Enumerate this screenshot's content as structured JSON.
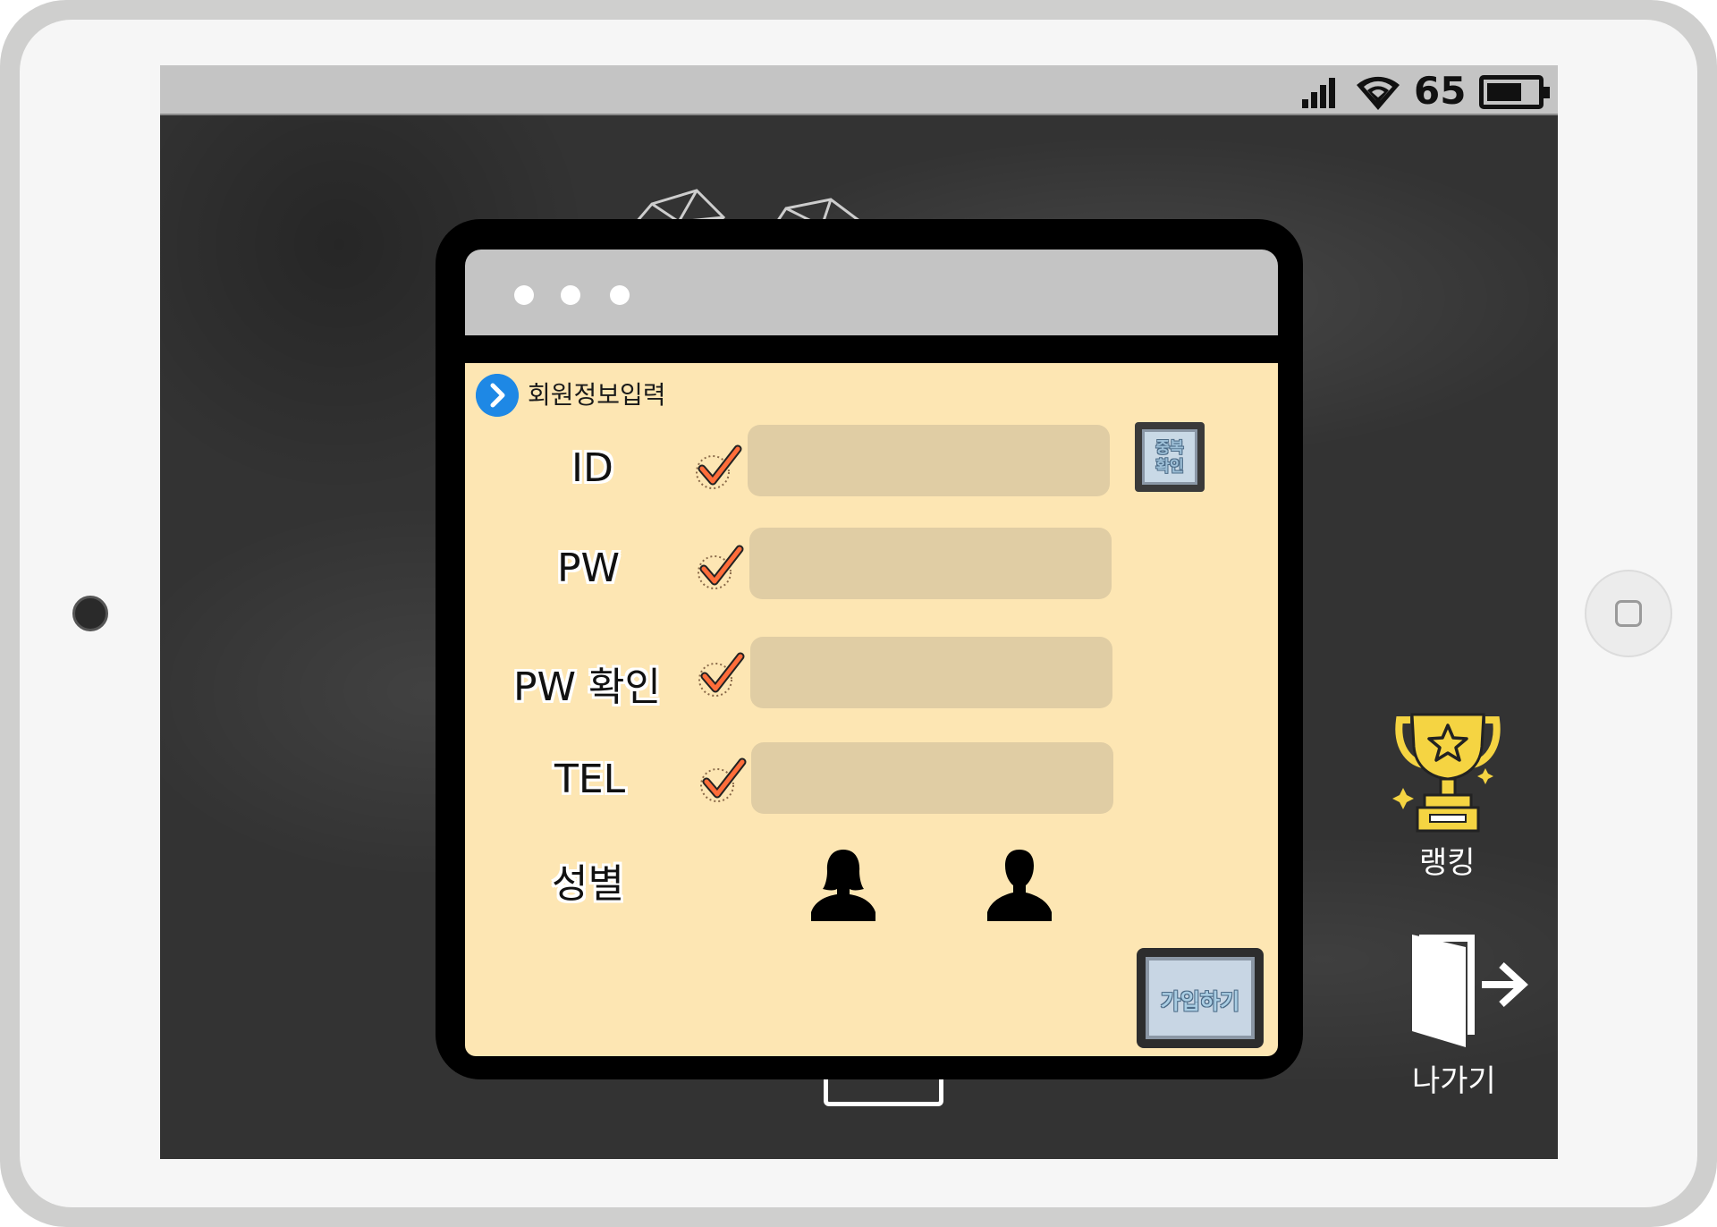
{
  "status_bar": {
    "battery_level": "65"
  },
  "form": {
    "header_title": "회원정보입력",
    "fields": [
      {
        "label": "ID",
        "value": "",
        "placeholder": ""
      },
      {
        "label": "PW",
        "value": "",
        "placeholder": ""
      },
      {
        "label": "PW 확인",
        "value": "",
        "placeholder": ""
      },
      {
        "label": "TEL",
        "value": "",
        "placeholder": ""
      }
    ],
    "duplicate_check_label": "중복 확인",
    "duplicate_check_line1": "중복",
    "duplicate_check_line2": "확인",
    "gender_label": "성별",
    "gender_options": [
      "female-silhouette-icon",
      "male-silhouette-icon"
    ],
    "submit_label": "가입하기"
  },
  "side_menu": {
    "ranking_label": "랭킹",
    "exit_label": "나가기"
  },
  "colors": {
    "panel_bg": "#fde6b3",
    "field_bg": "#e0cda4",
    "titlebar": "#c4c4c4",
    "accent_blue": "#1e88e5",
    "check_orange": "#ff6d3a",
    "trophy_gold": "#f5d442"
  }
}
